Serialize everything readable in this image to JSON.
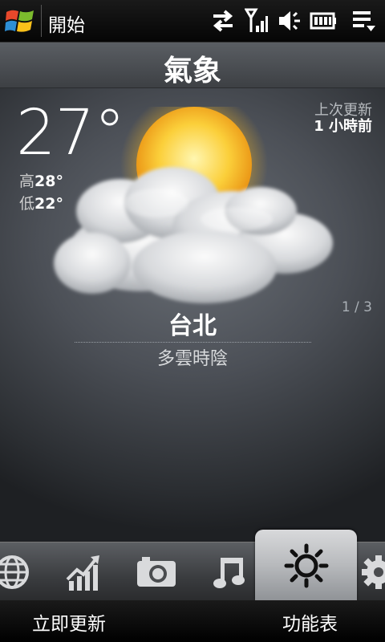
{
  "status_bar": {
    "start_label": "開始",
    "icons": [
      "windows-logo",
      "data-sync-icon",
      "signal-icon",
      "volume-icon",
      "battery-icon",
      "menu-icon"
    ]
  },
  "header": {
    "title": "氣象"
  },
  "weather": {
    "temperature": "27°",
    "high_label": "高",
    "high_value": "28°",
    "low_label": "低",
    "low_value": "22°",
    "last_update_label": "上次更新",
    "last_update_value": "1 小時前",
    "page_indicator": "1 / 3",
    "city": "台北",
    "condition": "多雲時陰",
    "icon": "partly-cloudy-icon"
  },
  "tabs": [
    {
      "name": "globe",
      "icon": "globe-icon",
      "active": false
    },
    {
      "name": "stocks",
      "icon": "stock-chart-icon",
      "active": false
    },
    {
      "name": "photos",
      "icon": "camera-icon",
      "active": false
    },
    {
      "name": "music",
      "icon": "music-note-icon",
      "active": false
    },
    {
      "name": "weather",
      "icon": "sun-icon",
      "active": true
    },
    {
      "name": "settings",
      "icon": "gear-icon",
      "active": false
    }
  ],
  "softkeys": {
    "left": "立即更新",
    "right": "功能表"
  },
  "colors": {
    "background": "#2b2e32",
    "accent_sun": "#f3b21a",
    "active_tab": "#c8c9cb"
  }
}
